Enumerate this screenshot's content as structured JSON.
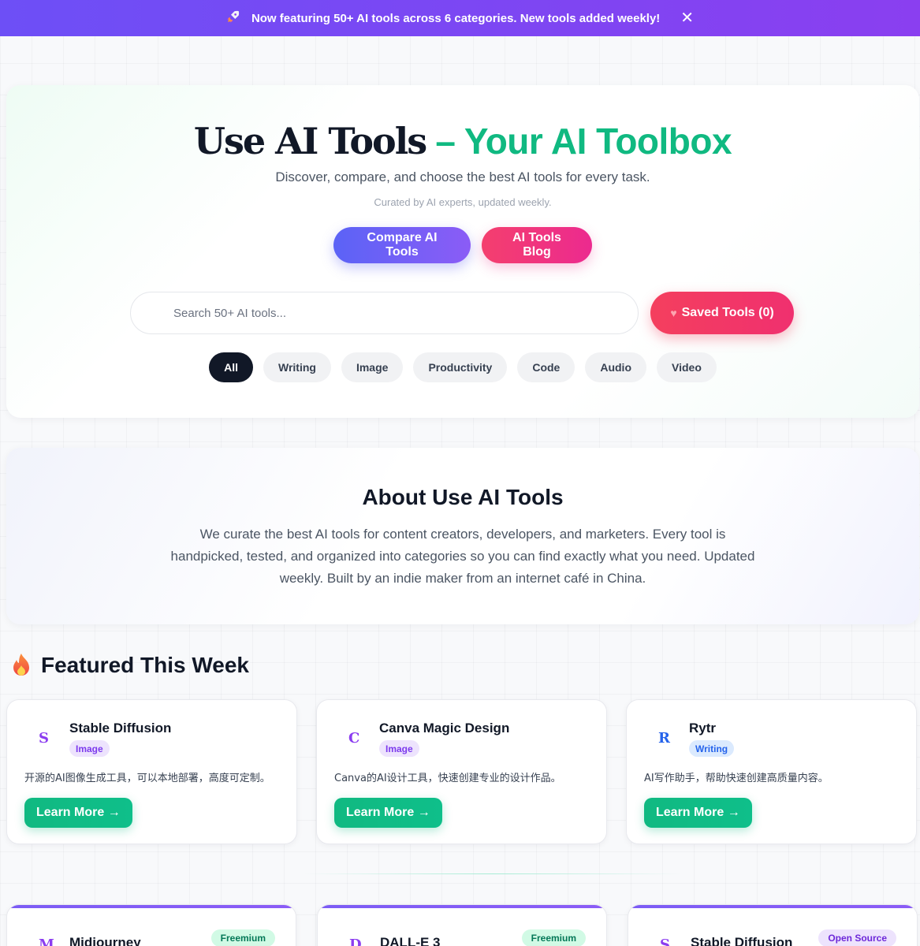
{
  "banner": {
    "icon": "rocket-icon",
    "text": "Now featuring 50+ AI tools across 6 categories. New tools added weekly!",
    "close_symbol": "✕"
  },
  "hero": {
    "brand": "Use AI Tools",
    "dash": " – ",
    "tagline": "Your AI Toolbox",
    "subtitle": "Discover, compare, and choose the best AI tools for every task.",
    "note": "Curated by AI experts, updated weekly.",
    "compare_label": "Compare AI Tools",
    "blog_label": "AI Tools Blog"
  },
  "search": {
    "placeholder": "Search 50+ AI tools...",
    "saved_label": "Saved Tools (0)"
  },
  "categories": [
    "All",
    "Writing",
    "Image",
    "Productivity",
    "Code",
    "Audio",
    "Video"
  ],
  "active_category": "All",
  "about": {
    "title": "About Use AI Tools",
    "text": "We curate the best AI tools for content creators, developers, and marketers. Every tool is handpicked, tested, and organized into categories so you can find exactly what you need. Updated weekly. Built by an indie maker from an internet café in China."
  },
  "featured": {
    "title": "Featured This Week",
    "learn_label": "Learn More →",
    "items": [
      {
        "letter": "S",
        "letter_color": "#8b3df0",
        "name": "Stable Diffusion",
        "badge": "Image",
        "badge_bg": "#ede3fd",
        "badge_color": "#7c3aed",
        "desc": "开源的AI图像生成工具，可以本地部署，高度可定制。"
      },
      {
        "letter": "C",
        "letter_color": "#8b3df0",
        "name": "Canva Magic Design",
        "badge": "Image",
        "badge_bg": "#ede3fd",
        "badge_color": "#7c3aed",
        "desc": "Canva的AI设计工具，快速创建专业的设计作品。"
      },
      {
        "letter": "R",
        "letter_color": "#2563eb",
        "name": "Rytr",
        "badge": "Writing",
        "badge_bg": "#dbeafe",
        "badge_color": "#2563eb",
        "desc": "AI写作助手，帮助快速创建高质量内容。"
      }
    ]
  },
  "tools": [
    {
      "letter": "M",
      "letter_color": "#8b3df0",
      "name": "Midjourney",
      "price": "Freemium",
      "price_bg": "#d1fae5",
      "price_color": "#047857"
    },
    {
      "letter": "D",
      "letter_color": "#8b3df0",
      "name": "DALL-E 3",
      "price": "Freemium",
      "price_bg": "#d1fae5",
      "price_color": "#047857"
    },
    {
      "letter": "S",
      "letter_color": "#8b3df0",
      "name": "Stable Diffusion",
      "price": "Open Source",
      "price_bg": "#ede3fd",
      "price_color": "#6d28d9"
    }
  ]
}
